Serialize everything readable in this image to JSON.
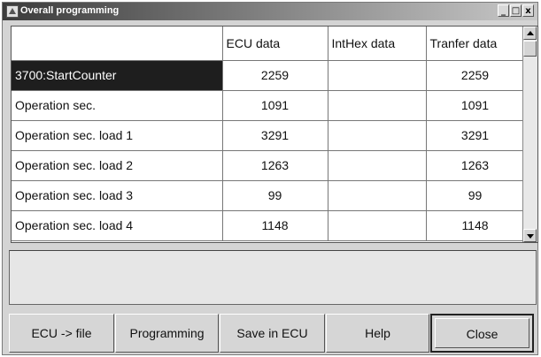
{
  "window": {
    "title": "Overall programming",
    "controls": {
      "minimize": "_",
      "maximize": "□",
      "close": "x"
    }
  },
  "grid": {
    "columns": [
      "",
      "ECU data",
      "IntHex data",
      "Tranfer data"
    ],
    "rows": [
      {
        "label": "3700:StartCounter",
        "ecu": "2259",
        "inthex": "",
        "transfer": "2259",
        "selected": true
      },
      {
        "label": "Operation sec.",
        "ecu": "1091",
        "inthex": "",
        "transfer": "1091"
      },
      {
        "label": "Operation sec. load 1",
        "ecu": "3291",
        "inthex": "",
        "transfer": "3291"
      },
      {
        "label": "Operation sec. load 2",
        "ecu": "1263",
        "inthex": "",
        "transfer": "1263"
      },
      {
        "label": "Operation sec. load 3",
        "ecu": "99",
        "inthex": "",
        "transfer": "99"
      },
      {
        "label": "Operation sec. load 4",
        "ecu": "1148",
        "inthex": "",
        "transfer": "1148"
      }
    ]
  },
  "message": "",
  "buttons": {
    "ecu_to_file": "ECU -> file",
    "programming": "Programming",
    "save_in_ecu": "Save in ECU",
    "help": "Help",
    "close": "Close"
  }
}
